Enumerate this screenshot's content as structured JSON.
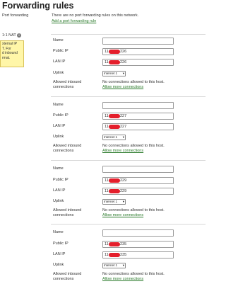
{
  "page": {
    "title": "Forwarding rules",
    "port_forwarding_label": "Port forwarding",
    "port_forwarding_text": "There are no port forwarding rules on this network.",
    "add_port_forwarding_link": "Add a port forwarding rule",
    "nat_label": "1:1 NAT",
    "nat_tooltip_lines": [
      "xternal IP",
      "T. For",
      "d inbound",
      "rmat."
    ]
  },
  "labels": {
    "name": "Name",
    "public_ip": "Public IP",
    "lan_ip": "LAN IP",
    "uplink": "Uplink",
    "allowed_inbound_1": "Allowed inbound",
    "allowed_inbound_2": "connections",
    "no_connections": "No connections allowed to this host.",
    "allow_more": "Allow more connections"
  },
  "rules": [
    {
      "name": "",
      "public_ip_prefix": "114",
      "public_ip_suffix": "226",
      "lan_ip_prefix": "114",
      "lan_ip_suffix": "226",
      "uplink": "Internet 1"
    },
    {
      "name": "",
      "public_ip_prefix": "114",
      "public_ip_suffix": "227",
      "lan_ip_prefix": "114",
      "lan_ip_suffix": "227",
      "uplink": "Internet 1"
    },
    {
      "name": "",
      "public_ip_prefix": "114",
      "public_ip_suffix": "229",
      "lan_ip_prefix": "114",
      "lan_ip_suffix": "229",
      "uplink": "Internet 1"
    },
    {
      "name": "",
      "public_ip_prefix": "114",
      "public_ip_suffix": "235",
      "lan_ip_prefix": "114",
      "lan_ip_suffix": "235",
      "uplink": "Internet 1"
    }
  ],
  "colors": {
    "link": "#2a7a2a",
    "redaction": "#e41e2b",
    "tooltip_bg": "#fff6a8"
  }
}
